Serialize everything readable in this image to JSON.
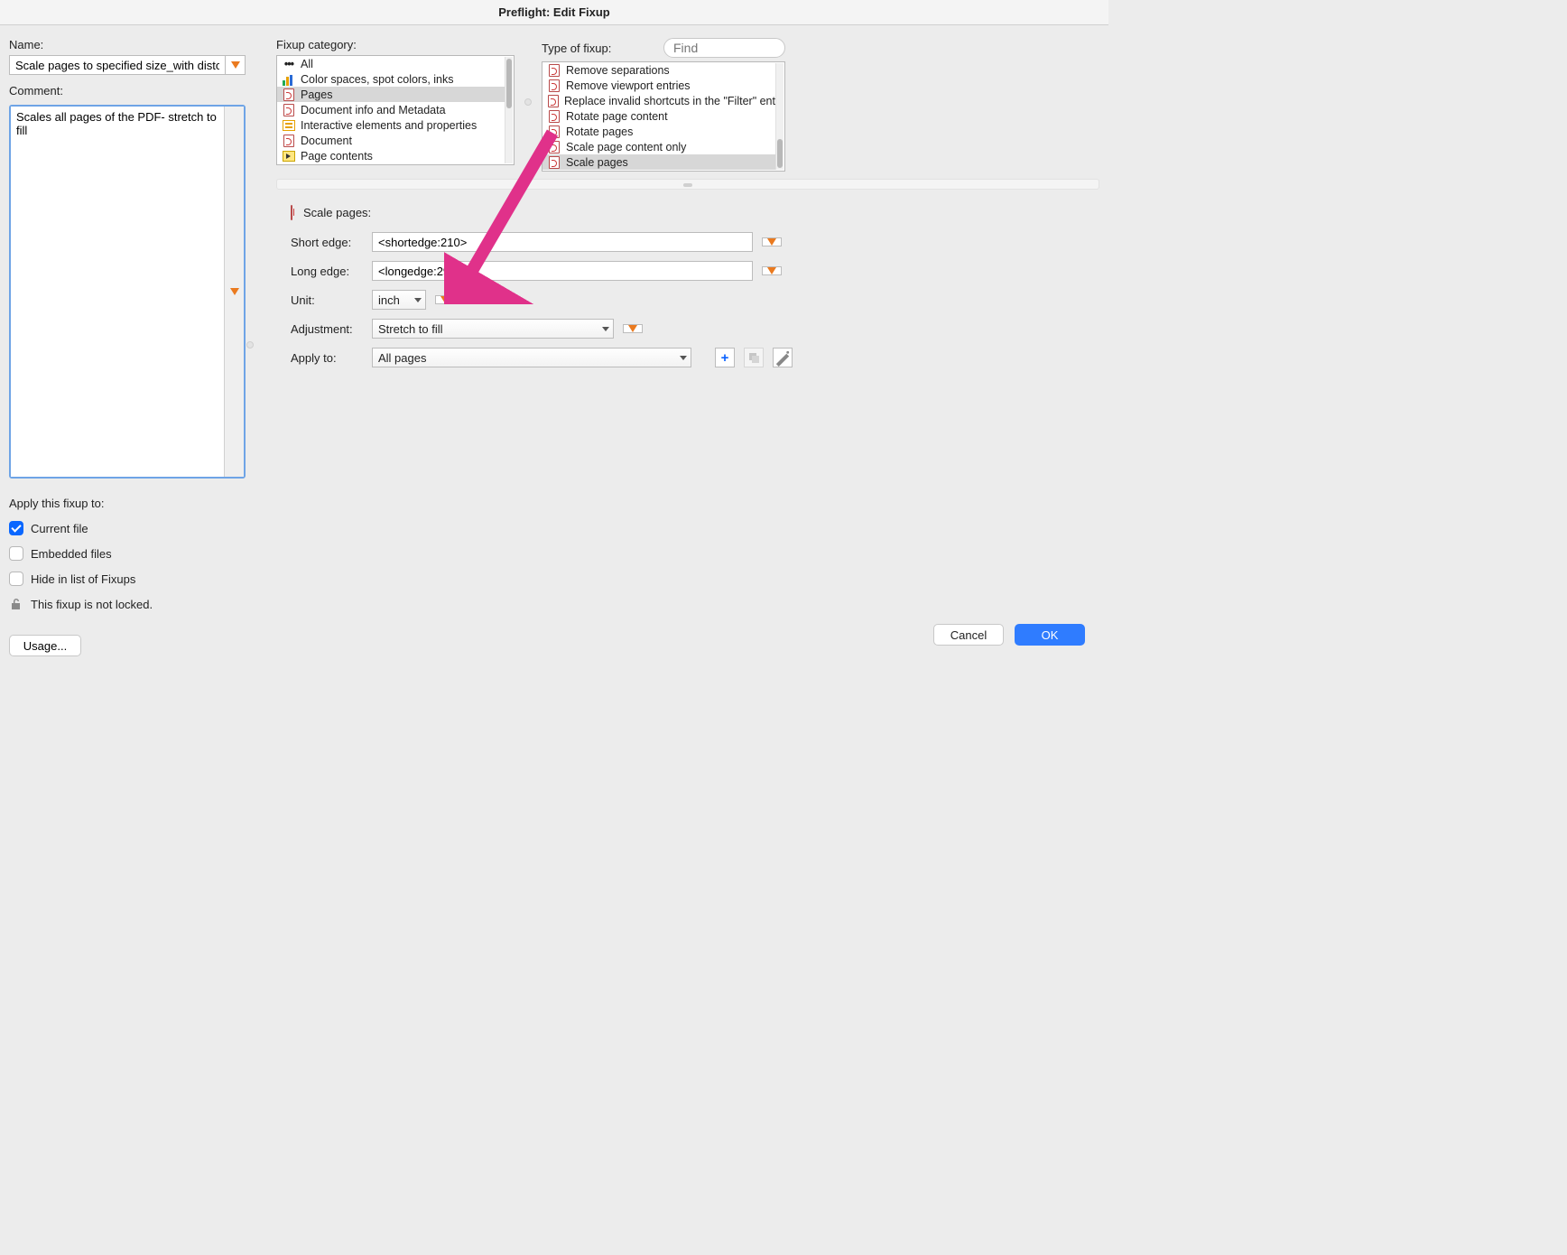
{
  "title": "Preflight: Edit Fixup",
  "left": {
    "name_label": "Name:",
    "name_value": "Scale pages to specified size_with distortion",
    "comment_label": "Comment:",
    "comment_value": "Scales all pages of the PDF- stretch to fill",
    "apply_label": "Apply this fixup to:",
    "chk_current": "Current file",
    "chk_embedded": "Embedded files",
    "chk_hide": "Hide in list of Fixups",
    "lock_text": "This fixup is not locked.",
    "usage_btn": "Usage..."
  },
  "lists": {
    "category_label": "Fixup category:",
    "categories": [
      {
        "icon": "dots",
        "label": "All"
      },
      {
        "icon": "bars",
        "label": "Color spaces, spot colors, inks"
      },
      {
        "icon": "pdf",
        "label": "Pages",
        "selected": true
      },
      {
        "icon": "pdf",
        "label": "Document info and Metadata"
      },
      {
        "icon": "lines",
        "label": "Interactive elements and properties"
      },
      {
        "icon": "pdf",
        "label": "Document"
      },
      {
        "icon": "arrow",
        "label": "Page contents"
      }
    ],
    "type_label": "Type of fixup:",
    "find_placeholder": "Find",
    "types": [
      {
        "label": "Remove separations"
      },
      {
        "label": "Remove viewport entries"
      },
      {
        "label": "Replace invalid shortcuts in the \"Filter\" entry in"
      },
      {
        "label": "Rotate page content"
      },
      {
        "label": "Rotate pages"
      },
      {
        "label": "Scale page content only"
      },
      {
        "label": "Scale pages",
        "selected": true
      }
    ]
  },
  "form": {
    "header": "Scale pages:",
    "short_edge_label": "Short edge:",
    "short_edge_value": "<shortedge:210>",
    "long_edge_label": "Long edge:",
    "long_edge_value": "<longedge:297>",
    "unit_label": "Unit:",
    "unit_value": "inch",
    "adjustment_label": "Adjustment:",
    "adjustment_value": "Stretch to fill",
    "apply_to_label": "Apply to:",
    "apply_to_value": "All pages"
  },
  "footer": {
    "cancel": "Cancel",
    "ok": "OK"
  }
}
